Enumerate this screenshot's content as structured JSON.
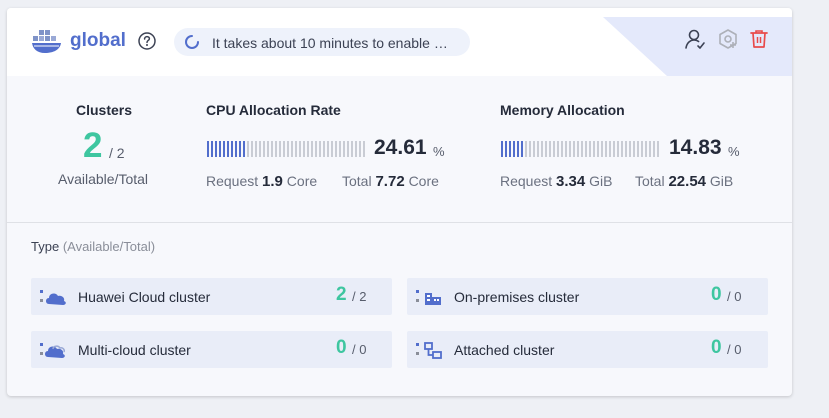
{
  "header": {
    "title": "global",
    "notice": "It takes about 10 minutes to enable …",
    "icons": [
      "docker-logo-icon",
      "help-icon",
      "loading-spinner-icon",
      "user-permission-icon",
      "add-plugin-icon",
      "delete-icon"
    ],
    "colors": {
      "title": "#526ecc",
      "delete": "#e84a4a",
      "accent_band": "#e4e9fb"
    }
  },
  "clusters": {
    "label": "Clusters",
    "available": "2",
    "total": "/ 2",
    "caption": "Available/Total"
  },
  "cpu": {
    "label": "CPU Allocation Rate",
    "rate": "24.61",
    "rate_fraction": 0.2461,
    "unit": "%",
    "request_label": "Request",
    "request_value": "1.9",
    "request_unit": "Core",
    "total_label": "Total",
    "total_value": "7.72",
    "total_unit": "Core"
  },
  "memory": {
    "label": "Memory Allocation",
    "rate": "14.83",
    "rate_fraction": 0.1483,
    "unit": "%",
    "request_label": "Request",
    "request_value": "3.34",
    "request_unit": "GiB",
    "total_label": "Total",
    "total_value": "22.54",
    "total_unit": "GiB"
  },
  "types": {
    "title": "Type",
    "title_hint": "(Available/Total)",
    "items": [
      {
        "name": "Huawei Cloud cluster",
        "available": "2",
        "total": "/ 2",
        "icon": "cloud-server-icon"
      },
      {
        "name": "On-premises cluster",
        "available": "0",
        "total": "/ 0",
        "icon": "on-premises-icon"
      },
      {
        "name": "Multi-cloud cluster",
        "available": "0",
        "total": "/ 0",
        "icon": "multi-cloud-icon"
      },
      {
        "name": "Attached cluster",
        "available": "0",
        "total": "/ 0",
        "icon": "attached-cluster-icon"
      }
    ]
  }
}
